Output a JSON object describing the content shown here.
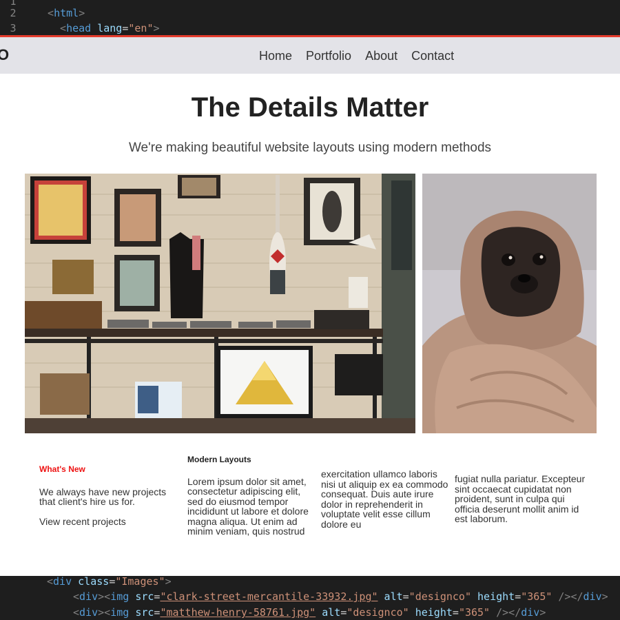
{
  "editor_top": {
    "lines": [
      {
        "num": "2",
        "open": "<",
        "tag": "html",
        "close": ">"
      },
      {
        "num": "3",
        "open": "<",
        "tag": "head",
        "attr": "lang",
        "eq": "=",
        "value": "\"en\"",
        "close": ">"
      }
    ]
  },
  "site": {
    "logo": "O",
    "nav": [
      "Home",
      "Portfolio",
      "About",
      "Contact"
    ],
    "hero_title": "The Details Matter",
    "hero_subtitle": "We're making beautiful website layouts using modern methods",
    "whats_new_heading": "What's New",
    "whats_new_text": "We always have new projects that client's hire us for.",
    "view_projects": "View recent projects",
    "modern_heading": "Modern Layouts",
    "col2_text": "Lorem ipsum dolor sit amet, consectetur adipiscing elit, sed do eiusmod tempor incididunt ut labore et dolore magna aliqua. Ut enim ad minim veniam, quis nostrud",
    "col3_text": "exercitation ullamco laboris nisi ut aliquip ex ea commodo consequat. Duis aute irure dolor in reprehenderit in voluptate velit esse cillum dolore eu",
    "col4_text": "fugiat nulla pariatur. Excepteur sint occaecat cupidatat non proident, sunt in culpa qui officia deserunt mollit anim id est laborum."
  },
  "editor_bottom": {
    "line1": {
      "open": "<",
      "tag": "div",
      "attr": "class",
      "eq": "=",
      "value": "\"Images\"",
      "close": ">"
    },
    "line2": {
      "open": "<",
      "tag": "div",
      "mid": "><",
      "tag2": "img",
      "attr1": "src",
      "value1": "\"clark-street-mercantile-33932.jpg\"",
      "attr2": "alt",
      "value2": "\"designco\"",
      "attr3": "height",
      "value3": "\"365\"",
      "end": " /></",
      "tag3": "div",
      "close": ">"
    },
    "line3": {
      "open": "<",
      "tag": "div",
      "mid": "><",
      "tag2": "img",
      "attr1": "src",
      "value1": "\"matthew-henry-58761.jpg\"",
      "attr2": "alt",
      "value2": "\"designco\"",
      "attr3": "height",
      "value3": "\"365\"",
      "end": " /></",
      "tag3": "div",
      "close": ">"
    }
  }
}
